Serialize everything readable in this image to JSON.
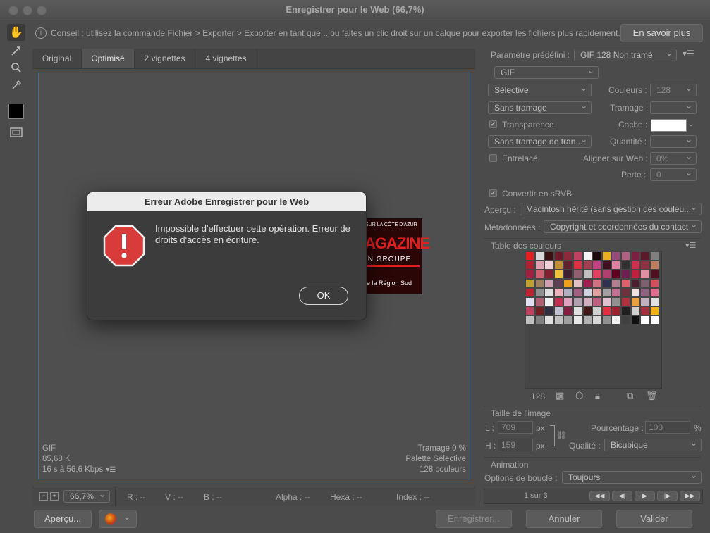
{
  "window": {
    "title": "Enregistrer pour le Web (66,7%)"
  },
  "tip": {
    "text": "Conseil : utilisez la commande Fichier > Exporter > Exporter en tant que... ou faites un clic droit sur un calque pour exporter les fichiers plus rapidement.",
    "learn_more": "En savoir plus"
  },
  "tabs": [
    "Original",
    "Optimisé",
    "2 vignettes",
    "4 vignettes"
  ],
  "preview_info": {
    "format": "GIF",
    "size": "85,68 K",
    "time": "16 s à 56,6 Kbps",
    "dither": "Tramage 0 %",
    "palette": "Palette Sélective",
    "colors": "128 couleurs"
  },
  "statusbar": {
    "zoom": "66,7%",
    "r": "R : --",
    "v": "V : --",
    "b": "B : --",
    "alpha": "Alpha : --",
    "hexa": "Hexa : --",
    "index": "Index : --"
  },
  "bottom": {
    "preview_btn": "Aperçu...",
    "save_btn": "Enregistrer...",
    "cancel_btn": "Annuler",
    "ok_btn": "Valider"
  },
  "settings": {
    "preset_label": "Paramètre prédéfini :",
    "preset_value": "GIF 128 Non tramé",
    "format": "GIF",
    "reduction": "Sélective",
    "colors_label": "Couleurs :",
    "colors_value": "128",
    "dither_algo": "Sans tramage",
    "dither_label": "Tramage :",
    "transparency": "Transparence",
    "matte_label": "Cache :",
    "transp_dither": "Sans tramage de tran...",
    "amount_label": "Quantité :",
    "interlaced": "Entrelacé",
    "websnap_label": "Aligner sur Web :",
    "websnap_value": "0%",
    "lossy_label": "Perte :",
    "lossy_value": "0",
    "srgb": "Convertir en sRVB",
    "preview_label": "Aperçu :",
    "preview_value": "Macintosh hérité (sans gestion des couleu...",
    "metadata_label": "Métadonnées :",
    "metadata_value": "Copyright et coordonnées du contact"
  },
  "color_table": {
    "title": "Table des couleurs",
    "count": "128"
  },
  "image_size": {
    "title": "Taille de l'image",
    "w_label": "L :",
    "w_value": "709",
    "w_unit": "px",
    "h_label": "H :",
    "h_value": "159",
    "h_unit": "px",
    "percent_label": "Pourcentage :",
    "percent_value": "100",
    "percent_unit": "%",
    "quality_label": "Qualité :",
    "quality_value": "Bicubique"
  },
  "animation": {
    "title": "Animation",
    "loop_label": "Options de boucle :",
    "loop_value": "Toujours",
    "frame": "1 sur 3"
  },
  "dialog": {
    "title": "Erreur Adobe Enregistrer pour le Web",
    "message": "Impossible d'effectuer cette opération. Erreur de droits d'accès en écriture.",
    "ok": "OK"
  },
  "image_text": {
    "top": "SUR LA CÔTE D'AZUR",
    "main": "AGAZINE",
    "sub": "IN GROUPE",
    "bottom": "le la Région Sud"
  },
  "colors": {
    "accent_blue": "#2f6ea8",
    "error_red": "#d93a3a"
  }
}
